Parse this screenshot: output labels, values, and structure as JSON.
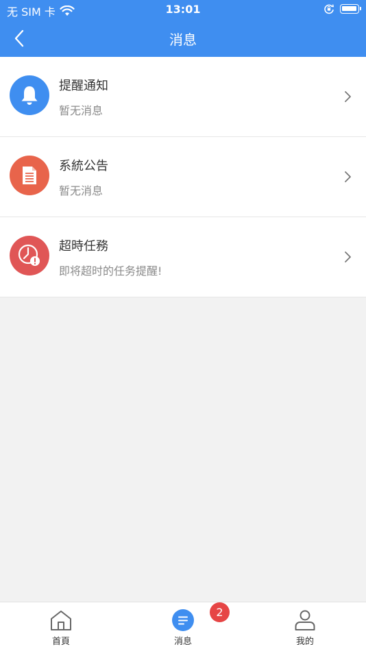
{
  "status_bar": {
    "carrier": "无 SIM 卡",
    "time": "13:01",
    "icons": [
      "wifi-icon",
      "rotation-lock-icon",
      "battery-icon"
    ]
  },
  "nav": {
    "title": "消息",
    "back_icon": "chevron-left-icon"
  },
  "messages": [
    {
      "title": "提醒通知",
      "subtitle": "暂无消息",
      "icon": "bell-icon",
      "color": "#3f8ef0"
    },
    {
      "title": "系統公告",
      "subtitle": "暂无消息",
      "icon": "document-icon",
      "color": "#e8644b"
    },
    {
      "title": "超時任務",
      "subtitle": "即将超时的任务提醒!",
      "icon": "clock-alert-icon",
      "color": "#e05656"
    }
  ],
  "tab_bar": {
    "tabs": [
      {
        "label": "首頁",
        "icon": "home-icon",
        "active": false
      },
      {
        "label": "消息",
        "icon": "message-icon",
        "active": true
      },
      {
        "label": "我的",
        "icon": "user-icon",
        "active": false
      }
    ],
    "message_badge": "2"
  },
  "colors": {
    "primary": "#3f8ef0",
    "badge": "#e64545",
    "background": "#f2f2f2"
  }
}
